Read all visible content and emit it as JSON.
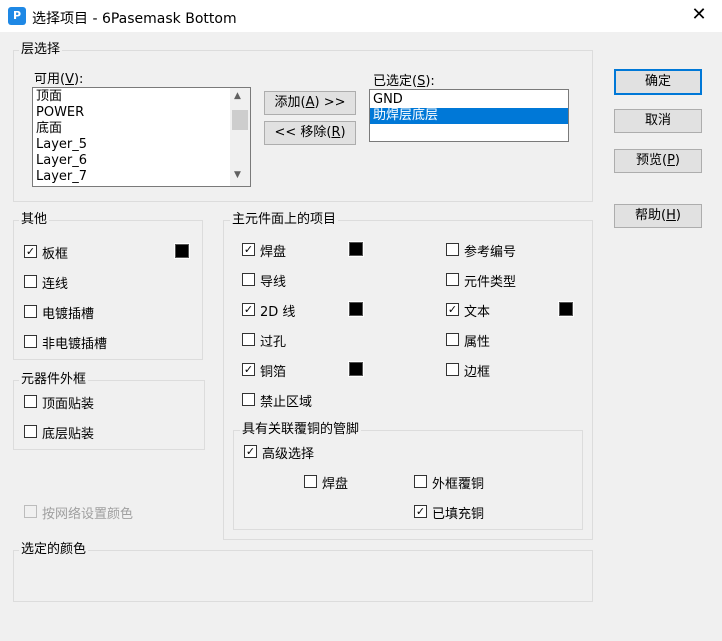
{
  "window": {
    "title": "选择项目 - 6Pasemask Bottom",
    "icon": "app-icon",
    "close_glyph": "✕"
  },
  "layer_select": {
    "legend": "层选择",
    "available_label": "可用(V):",
    "available_items": [
      "顶面",
      "POWER",
      "底面",
      "Layer_5",
      "Layer_6",
      "Layer_7"
    ],
    "selected_label": "已选定(S):",
    "selected_items": [
      "GND",
      "助焊层底层"
    ],
    "selected_highlight_index": 1,
    "add_button": "添加(A) >>",
    "remove_button": "<< 移除(R)"
  },
  "buttons": {
    "ok": "确定",
    "cancel": "取消",
    "preview": "预览(P)",
    "help": "帮助(H)"
  },
  "other": {
    "legend": "其他",
    "items": [
      {
        "label": "板框",
        "checked": true,
        "color": "#000000"
      },
      {
        "label": "连线",
        "checked": false
      },
      {
        "label": "电镀插槽",
        "checked": false
      },
      {
        "label": "非电镀插槽",
        "checked": false
      }
    ]
  },
  "component_outline": {
    "legend": "元器件外框",
    "items": [
      {
        "label": "顶面贴装",
        "checked": false
      },
      {
        "label": "底层贴装",
        "checked": false
      }
    ]
  },
  "net_color": {
    "label": "按网络设置颜色",
    "checked": false,
    "disabled": true
  },
  "main_items": {
    "legend": "主元件面上的项目",
    "left": [
      {
        "label": "焊盘",
        "checked": true,
        "color": "#000000"
      },
      {
        "label": "导线",
        "checked": false
      },
      {
        "label": "2D 线",
        "checked": true,
        "color": "#000000"
      },
      {
        "label": "过孔",
        "checked": false
      },
      {
        "label": "铜箔",
        "checked": true,
        "color": "#000000"
      },
      {
        "label": "禁止区域",
        "checked": false
      }
    ],
    "right": [
      {
        "label": "参考编号",
        "checked": false
      },
      {
        "label": "元件类型",
        "checked": false
      },
      {
        "label": "文本",
        "checked": true,
        "color": "#000000"
      },
      {
        "label": "属性",
        "checked": false
      },
      {
        "label": "边框",
        "checked": false
      }
    ]
  },
  "copper_pins": {
    "legend": "具有关联覆铜的管脚",
    "advanced": {
      "label": "高级选择",
      "checked": true
    },
    "pad": {
      "label": "焊盘",
      "checked": false
    },
    "outline_copper": {
      "label": "外框覆铜",
      "checked": false
    },
    "filled_copper": {
      "label": "已填充铜",
      "checked": true
    }
  },
  "selected_color": {
    "legend": "选定的颜色"
  },
  "check_glyph": "✓",
  "scroll_up": "▲",
  "scroll_down": "▼"
}
